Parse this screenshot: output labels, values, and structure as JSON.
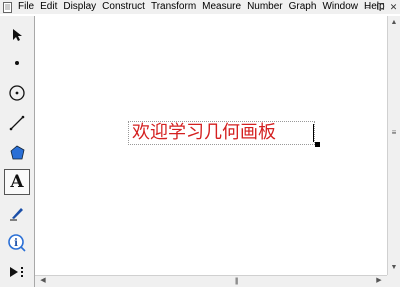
{
  "menubar": {
    "items": [
      "File",
      "Edit",
      "Display",
      "Construct",
      "Transform",
      "Measure",
      "Number",
      "Graph",
      "Window",
      "Help"
    ],
    "window_controls": [
      "–",
      "❐",
      "✕"
    ]
  },
  "toolbox": {
    "tools": [
      "selection-arrow",
      "point",
      "compass",
      "straightedge",
      "polygon",
      "text",
      "marker",
      "information",
      "custom-tools"
    ],
    "active_tool": "text",
    "text_tool_label": "A"
  },
  "canvas": {
    "text_object": "欢迎学习几何画板",
    "text_color": "#d42020"
  },
  "scrollbars": {
    "grip": "|||"
  }
}
